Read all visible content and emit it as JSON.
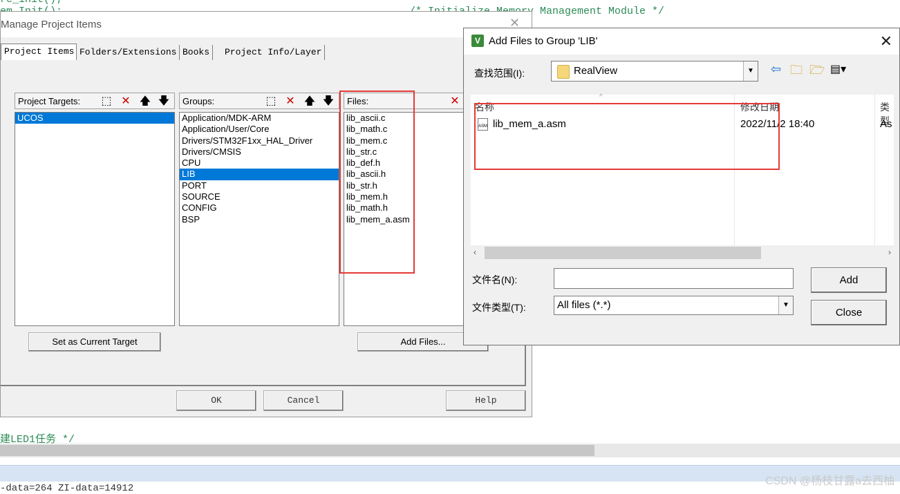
{
  "background": {
    "code_lines": [
      {
        "text": "re_init();"
      },
      {
        "text": "em_Init();",
        "comment": "/* Initialize Memory Management Module */"
      },
      {
        "text": "建LED1任务 */"
      },
      {
        "text": "-data=264 ZI-data=14912"
      }
    ],
    "watermark": "CSDN @杨枝甘露a去西柚"
  },
  "manage": {
    "title": "Manage Project Items",
    "tabs": [
      "Project Items",
      "Folders/Extensions",
      "Books",
      "Project Info/Layer"
    ],
    "targets_label": "Project Targets:",
    "targets": [
      "UCOS"
    ],
    "groups_label": "Groups:",
    "groups": [
      "Application/MDK-ARM",
      "Application/User/Core",
      "Drivers/STM32F1xx_HAL_Driver",
      "Drivers/CMSIS",
      "CPU",
      "LIB",
      "PORT",
      "SOURCE",
      "CONFIG",
      "BSP"
    ],
    "selected_group": "LIB",
    "files_label": "Files:",
    "files": [
      "lib_ascii.c",
      "lib_math.c",
      "lib_mem.c",
      "lib_str.c",
      "lib_def.h",
      "lib_ascii.h",
      "lib_str.h",
      "lib_mem.h",
      "lib_math.h",
      "lib_mem_a.asm"
    ],
    "set_target_button": "Set as Current Target",
    "add_files_button": "Add Files...",
    "ok_button": "OK",
    "cancel_button": "Cancel",
    "help_button": "Help"
  },
  "addfiles": {
    "title": "Add Files to Group 'LIB'",
    "lookin_label": "查找范围(I):",
    "lookin_value": "RealView",
    "col_name": "名称",
    "col_date": "修改日期",
    "col_type": "类型",
    "file_name": "lib_mem_a.asm",
    "file_date": "2022/11/2 18:40",
    "file_type": "As",
    "filename_label": "文件名(N):",
    "filename_value": "",
    "filetype_label": "文件类型(T):",
    "filetype_value": "All files (*.*)",
    "add_button": "Add",
    "close_button": "Close"
  },
  "colors": {
    "accent": "#0078d7",
    "highlight_box": "#e53935",
    "code_comment": "#2e8b57"
  }
}
